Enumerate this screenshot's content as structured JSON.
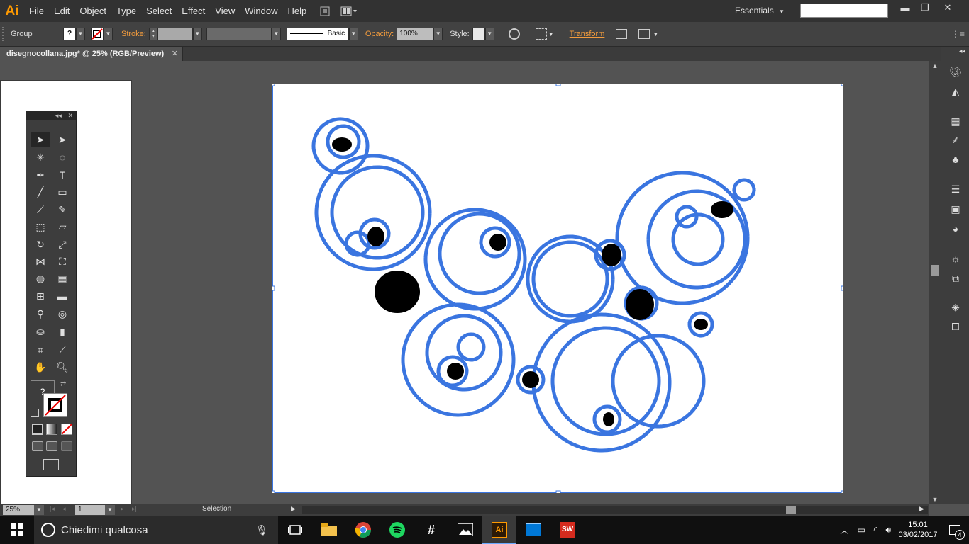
{
  "menubar": {
    "logo": "Ai",
    "items": [
      "File",
      "Edit",
      "Object",
      "Type",
      "Select",
      "Effect",
      "View",
      "Window",
      "Help"
    ],
    "workspace": "Essentials",
    "window_controls": {
      "minimize": "▬",
      "restore": "❐",
      "close": "✕"
    }
  },
  "controlbar": {
    "selection_type": "Group",
    "fill_value": "?",
    "stroke_label": "Stroke:",
    "brush_style": "Basic",
    "opacity_label": "Opacity:",
    "opacity_value": "100%",
    "style_label": "Style:",
    "transform_link": "Transform"
  },
  "document": {
    "tab_title": "disegnocollana.jpg* @ 25% (RGB/Preview)",
    "close": "✕"
  },
  "tools_panel": {
    "collapse": "◂◂",
    "close": "✕"
  },
  "statusbar": {
    "zoom": "25%",
    "artboard_number": "1",
    "current_tool": "Selection"
  },
  "taskbar": {
    "search_placeholder": "Chiedimi qualcosa",
    "time": "15:01",
    "date": "03/02/2017",
    "notification_count": "4"
  },
  "colors": {
    "accent": "#ff9a00",
    "trace_blue": "#3a75e0",
    "panel_bg": "#3d3d3d",
    "canvas_bg": "#535353"
  }
}
